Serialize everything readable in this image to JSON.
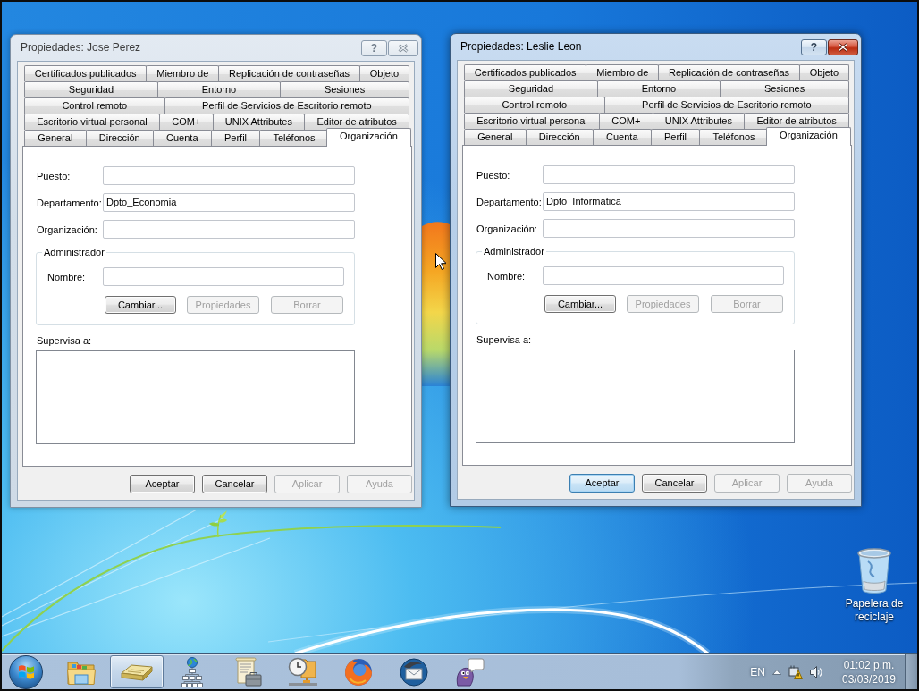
{
  "dialogs": [
    {
      "title": "Propiedades: Jose Perez",
      "active": false,
      "help_button": "?",
      "tab_rows": [
        {
          "tabs": [
            {
              "label": "Certificados publicados",
              "selected": false
            },
            {
              "label": "Miembro de",
              "selected": false
            },
            {
              "label": "Replicación de contraseñas",
              "selected": false
            },
            {
              "label": "Objeto",
              "selected": false
            }
          ]
        },
        {
          "tabs": [
            {
              "label": "Seguridad",
              "selected": false
            },
            {
              "label": "Entorno",
              "selected": false
            },
            {
              "label": "Sesiones",
              "selected": false
            }
          ]
        },
        {
          "tabs": [
            {
              "label": "Control remoto",
              "selected": false
            },
            {
              "label": "Perfil de Servicios de Escritorio remoto",
              "selected": false
            }
          ]
        },
        {
          "tabs": [
            {
              "label": "Escritorio virtual personal",
              "selected": false
            },
            {
              "label": "COM+",
              "selected": false
            },
            {
              "label": "UNIX Attributes",
              "selected": false
            },
            {
              "label": "Editor de atributos",
              "selected": false
            }
          ]
        },
        {
          "tabs": [
            {
              "label": "General",
              "selected": false
            },
            {
              "label": "Dirección",
              "selected": false
            },
            {
              "label": "Cuenta",
              "selected": false
            },
            {
              "label": "Perfil",
              "selected": false
            },
            {
              "label": "Teléfonos",
              "selected": false
            },
            {
              "label": "Organización",
              "selected": true
            }
          ]
        }
      ],
      "fields": [
        {
          "label": "Puesto:"
        },
        {
          "label": "Departamento:",
          "value": "Dpto_Economia"
        },
        {
          "label": "Organización:"
        }
      ],
      "manager": {
        "title": "Administrador",
        "label": "Nombre:",
        "buttons": [
          {
            "label": "Cambiar...",
            "disabled": false
          },
          {
            "label": "Propiedades",
            "disabled": true
          },
          {
            "label": "Borrar",
            "disabled": true
          }
        ]
      },
      "reports": {
        "label": "Supervisa a:"
      },
      "buttons": [
        {
          "label": "Aceptar",
          "disabled": false,
          "focused": false
        },
        {
          "label": "Cancelar",
          "disabled": false,
          "focused": false
        },
        {
          "label": "Aplicar",
          "disabled": true,
          "focused": false
        },
        {
          "label": "Ayuda",
          "disabled": true,
          "focused": false
        }
      ]
    },
    {
      "title": "Propiedades: Leslie Leon",
      "active": true,
      "help_button": "?",
      "tab_rows": [
        {
          "tabs": [
            {
              "label": "Certificados publicados",
              "selected": false
            },
            {
              "label": "Miembro de",
              "selected": false
            },
            {
              "label": "Replicación de contraseñas",
              "selected": false
            },
            {
              "label": "Objeto",
              "selected": false
            }
          ]
        },
        {
          "tabs": [
            {
              "label": "Seguridad",
              "selected": false
            },
            {
              "label": "Entorno",
              "selected": false
            },
            {
              "label": "Sesiones",
              "selected": false
            }
          ]
        },
        {
          "tabs": [
            {
              "label": "Control remoto",
              "selected": false
            },
            {
              "label": "Perfil de Servicios de Escritorio remoto",
              "selected": false
            }
          ]
        },
        {
          "tabs": [
            {
              "label": "Escritorio virtual personal",
              "selected": false
            },
            {
              "label": "COM+",
              "selected": false
            },
            {
              "label": "UNIX Attributes",
              "selected": false
            },
            {
              "label": "Editor de atributos",
              "selected": false
            }
          ]
        },
        {
          "tabs": [
            {
              "label": "General",
              "selected": false
            },
            {
              "label": "Dirección",
              "selected": false
            },
            {
              "label": "Cuenta",
              "selected": false
            },
            {
              "label": "Perfil",
              "selected": false
            },
            {
              "label": "Teléfonos",
              "selected": false
            },
            {
              "label": "Organización",
              "selected": true
            }
          ]
        }
      ],
      "fields": [
        {
          "label": "Puesto:"
        },
        {
          "label": "Departamento:",
          "value": "Dpto_Informatica"
        },
        {
          "label": "Organización:"
        }
      ],
      "manager": {
        "title": "Administrador",
        "label": "Nombre:",
        "buttons": [
          {
            "label": "Cambiar...",
            "disabled": false
          },
          {
            "label": "Propiedades",
            "disabled": true
          },
          {
            "label": "Borrar",
            "disabled": true
          }
        ]
      },
      "reports": {
        "label": "Supervisa a:"
      },
      "buttons": [
        {
          "label": "Aceptar",
          "disabled": false,
          "focused": true
        },
        {
          "label": "Cancelar",
          "disabled": false,
          "focused": false
        },
        {
          "label": "Aplicar",
          "disabled": true,
          "focused": false
        },
        {
          "label": "Ayuda",
          "disabled": true,
          "focused": false
        }
      ]
    }
  ],
  "desktop_icons": [
    {
      "label": "Papelera de reciclaje"
    }
  ],
  "taskbar": {
    "items": [
      {
        "kind": "folder",
        "selected": false
      },
      {
        "kind": "scanner",
        "selected": true
      },
      {
        "kind": "network",
        "selected": false
      },
      {
        "kind": "scroll",
        "selected": false
      },
      {
        "kind": "clock",
        "selected": false
      },
      {
        "kind": "browser",
        "selected": false
      },
      {
        "kind": "mail",
        "selected": false
      },
      {
        "kind": "chat",
        "selected": false
      }
    ],
    "tray": {
      "language": "EN",
      "time": "01:02 p.m.",
      "date": "03/03/2019"
    }
  }
}
